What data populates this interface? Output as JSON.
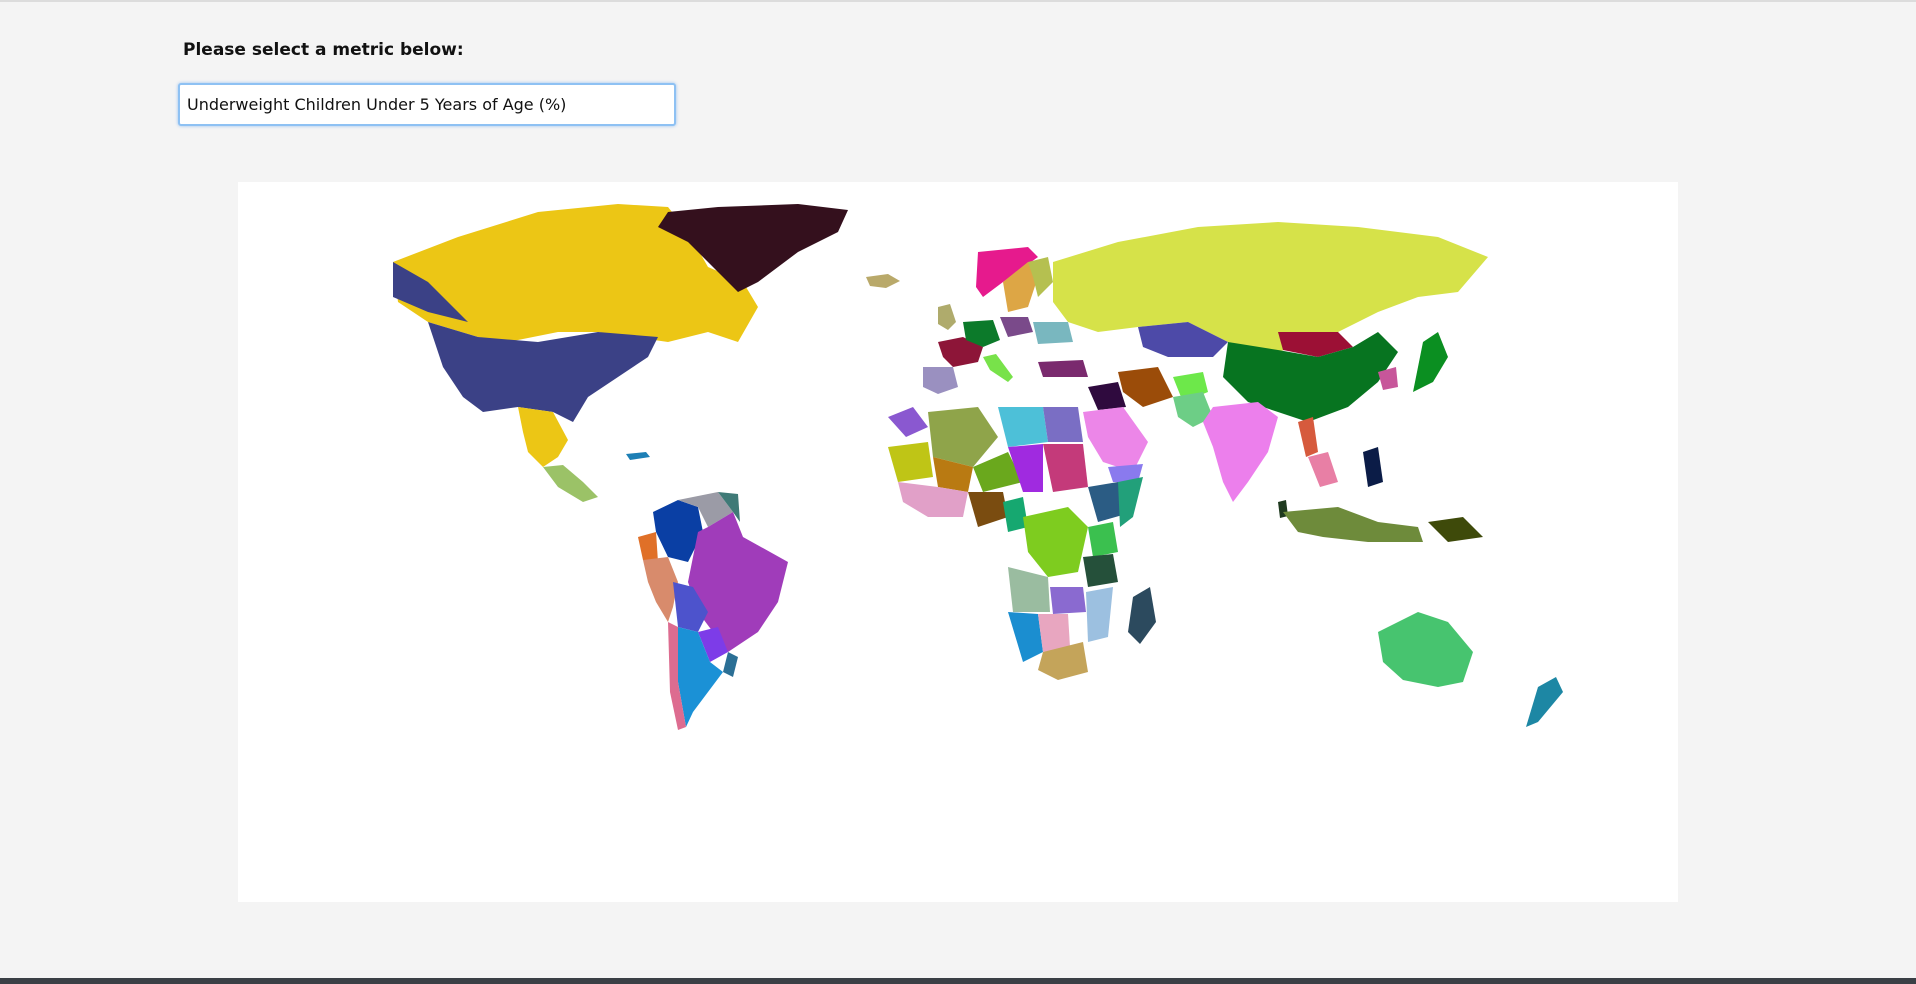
{
  "prompt_label": "Please select a metric below:",
  "metric_select": {
    "selected": "Underweight Children Under 5 Years of Age (%)",
    "options": [
      "Underweight Children Under 5 Years of Age (%)"
    ]
  },
  "map": {
    "type": "choropleth-world-map",
    "legend": "none",
    "regions": [
      {
        "name": "canada",
        "color": "#ecc615"
      },
      {
        "name": "usa",
        "color": "#3b4186"
      },
      {
        "name": "alaska",
        "color": "#3b4186"
      },
      {
        "name": "greenland",
        "color": "#34101d"
      },
      {
        "name": "iceland",
        "color": "#b9a96a"
      },
      {
        "name": "mexico",
        "color": "#ecc615"
      },
      {
        "name": "central-america",
        "color": "#9bc267"
      },
      {
        "name": "cuba",
        "color": "#1d7fb5"
      },
      {
        "name": "colombia",
        "color": "#0a3fa4"
      },
      {
        "name": "venezuela",
        "color": "#9b9ba6"
      },
      {
        "name": "guyana",
        "color": "#3f7a77"
      },
      {
        "name": "ecuador",
        "color": "#e07028"
      },
      {
        "name": "peru",
        "color": "#d88b6c"
      },
      {
        "name": "brazil",
        "color": "#a03cba"
      },
      {
        "name": "bolivia",
        "color": "#4d53cc"
      },
      {
        "name": "paraguay",
        "color": "#7d3ce8"
      },
      {
        "name": "uruguay",
        "color": "#2b6f95"
      },
      {
        "name": "chile",
        "color": "#dd6c90"
      },
      {
        "name": "argentina",
        "color": "#1b91d6"
      },
      {
        "name": "norway",
        "color": "#e61a8d"
      },
      {
        "name": "sweden",
        "color": "#dda645"
      },
      {
        "name": "finland",
        "color": "#b5c050"
      },
      {
        "name": "russia",
        "color": "#d6e249"
      },
      {
        "name": "uk",
        "color": "#afab6c"
      },
      {
        "name": "france",
        "color": "#8d1538"
      },
      {
        "name": "spain",
        "color": "#9a90c0"
      },
      {
        "name": "germany",
        "color": "#0c7a2a"
      },
      {
        "name": "poland",
        "color": "#7a4a8a"
      },
      {
        "name": "ukraine",
        "color": "#79b7bf"
      },
      {
        "name": "italy",
        "color": "#78e24a"
      },
      {
        "name": "turkey",
        "color": "#7a2a6e"
      },
      {
        "name": "kazakhstan",
        "color": "#4d4aa8"
      },
      {
        "name": "mongolia",
        "color": "#9c1035"
      },
      {
        "name": "china",
        "color": "#077420"
      },
      {
        "name": "iran",
        "color": "#9b4c09"
      },
      {
        "name": "afghanistan",
        "color": "#6de84a"
      },
      {
        "name": "pakistan",
        "color": "#6dce86"
      },
      {
        "name": "india",
        "color": "#ec7fec"
      },
      {
        "name": "saudi-arabia",
        "color": "#ec86e8"
      },
      {
        "name": "iraq",
        "color": "#2f0a3e"
      },
      {
        "name": "yemen",
        "color": "#8a7aee"
      },
      {
        "name": "myanmar",
        "color": "#d65a3d"
      },
      {
        "name": "thailand",
        "color": "#e87fa5"
      },
      {
        "name": "indonesia",
        "color": "#6e8b3b"
      },
      {
        "name": "philippines",
        "color": "#0b1c47"
      },
      {
        "name": "papua-new-guinea",
        "color": "#3e4a0a"
      },
      {
        "name": "japan",
        "color": "#0b8f21"
      },
      {
        "name": "korea",
        "color": "#c7569a"
      },
      {
        "name": "sri-lanka",
        "color": "#1f3a1f"
      },
      {
        "name": "australia",
        "color": "#47c46f"
      },
      {
        "name": "new-zealand",
        "color": "#1d87a4"
      },
      {
        "name": "morocco",
        "color": "#8a58d0"
      },
      {
        "name": "algeria",
        "color": "#8fa44a"
      },
      {
        "name": "libya",
        "color": "#4dc0d8"
      },
      {
        "name": "egypt",
        "color": "#7a6ec4"
      },
      {
        "name": "mauritania",
        "color": "#bfc516"
      },
      {
        "name": "mali",
        "color": "#b97a12"
      },
      {
        "name": "niger",
        "color": "#6aa81d"
      },
      {
        "name": "chad",
        "color": "#a02ae0"
      },
      {
        "name": "sudan",
        "color": "#c43a7a"
      },
      {
        "name": "ethiopia",
        "color": "#2b5c84"
      },
      {
        "name": "somalia",
        "color": "#22a07a"
      },
      {
        "name": "nigeria",
        "color": "#7a4c10"
      },
      {
        "name": "west-africa",
        "color": "#e1a0c8"
      },
      {
        "name": "drc",
        "color": "#7ecc1f"
      },
      {
        "name": "cameroon",
        "color": "#16a870"
      },
      {
        "name": "tanzania",
        "color": "#25503a"
      },
      {
        "name": "kenya",
        "color": "#3bc04f"
      },
      {
        "name": "angola",
        "color": "#9abca0"
      },
      {
        "name": "zambia",
        "color": "#8a6ad0"
      },
      {
        "name": "namibia",
        "color": "#1b8ed0"
      },
      {
        "name": "botswana",
        "color": "#e8a6c0"
      },
      {
        "name": "south-africa",
        "color": "#c4a45a"
      },
      {
        "name": "mozambique",
        "color": "#9cc0e0"
      },
      {
        "name": "madagascar",
        "color": "#2c4a5e"
      }
    ]
  }
}
